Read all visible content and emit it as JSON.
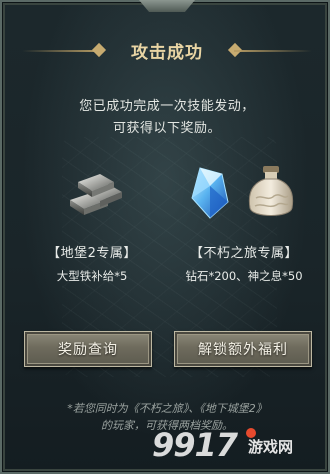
{
  "dialog": {
    "title": "攻击成功",
    "desc_line1": "您已成功完成一次技能发动，",
    "desc_line2": "可获得以下奖励。"
  },
  "rewards": {
    "group1": {
      "label": "【地堡2专属】",
      "items_text": "大型铁补给*5",
      "icons": [
        "iron-ingots-icon"
      ]
    },
    "group2": {
      "label": "【不朽之旅专属】",
      "items_text": "钻石*200、神之息*50",
      "icons": [
        "diamond-crystal-icon",
        "breath-jar-icon"
      ]
    }
  },
  "buttons": {
    "query": "奖励查询",
    "unlock": "解锁额外福利"
  },
  "footnote": {
    "line1": "*若您同时为《不朽之旅》、《地下城堡2》",
    "line2": "的玩家，可获得两档奖励。"
  },
  "watermark": {
    "number": "9917",
    "text": "游戏网"
  },
  "colors": {
    "title": "#e9d5a4",
    "panel_bg": "#1c282c",
    "button": "#6e6b5d",
    "watermark_dot": "#e74a2e"
  }
}
